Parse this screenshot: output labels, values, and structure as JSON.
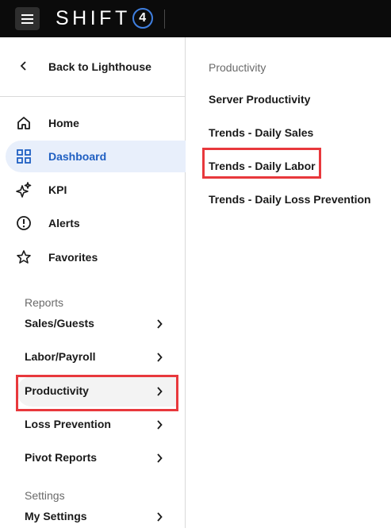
{
  "header": {
    "logo_text": "SHIFT",
    "logo_mark": "4",
    "menu_icon": "hamburger-menu-icon"
  },
  "sidebar": {
    "back_label": "Back to Lighthouse",
    "nav": [
      {
        "label": "Home",
        "icon": "home-icon"
      },
      {
        "label": "Dashboard",
        "icon": "grid-icon",
        "active": true
      },
      {
        "label": "KPI",
        "icon": "sparkle-icon"
      },
      {
        "label": "Alerts",
        "icon": "alert-icon"
      },
      {
        "label": "Favorites",
        "icon": "star-icon"
      }
    ],
    "reports_heading": "Reports",
    "reports": [
      {
        "label": "Sales/Guests"
      },
      {
        "label": "Labor/Payroll"
      },
      {
        "label": "Productivity",
        "selected": true
      },
      {
        "label": "Loss Prevention"
      },
      {
        "label": "Pivot Reports"
      }
    ],
    "settings_heading": "Settings",
    "settings": [
      {
        "label": "My Settings"
      }
    ]
  },
  "submenu": {
    "title": "Productivity",
    "items": [
      {
        "label": "Server Productivity"
      },
      {
        "label": "Trends - Daily Sales"
      },
      {
        "label": "Trends - Daily Labor",
        "highlighted": true
      },
      {
        "label": "Trends - Daily Loss Prevention"
      }
    ]
  },
  "colors": {
    "topbar": "#0b0b0b",
    "accent_blue": "#1f5fc2",
    "active_bg": "#e8effb",
    "highlight_red": "#e8383c"
  }
}
